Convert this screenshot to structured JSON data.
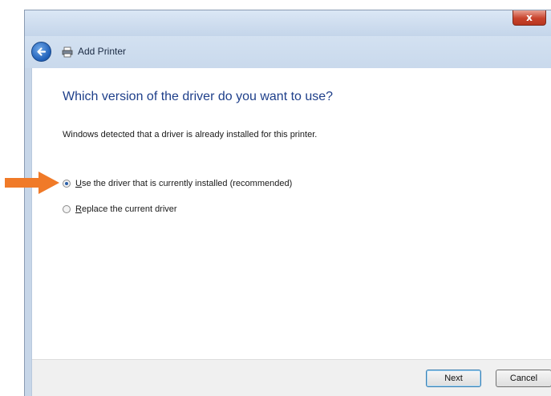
{
  "window": {
    "title": "Add Printer",
    "close_label": "x"
  },
  "page": {
    "heading": "Which version of the driver do you want to use?",
    "description": "Windows detected that a driver is already installed for this printer."
  },
  "options": [
    {
      "accel": "U",
      "rest": "se the driver that is currently installed (recommended)",
      "selected": true
    },
    {
      "accel": "R",
      "rest": "eplace the current driver",
      "selected": false
    }
  ],
  "footer": {
    "next_label": "Next",
    "cancel_label": "Cancel"
  },
  "colors": {
    "pointer_arrow": "#f07a28",
    "heading": "#1e3f8a"
  },
  "icons": [
    "back-arrow-icon",
    "printer-icon",
    "close-icon",
    "pointer-arrow-icon"
  ]
}
